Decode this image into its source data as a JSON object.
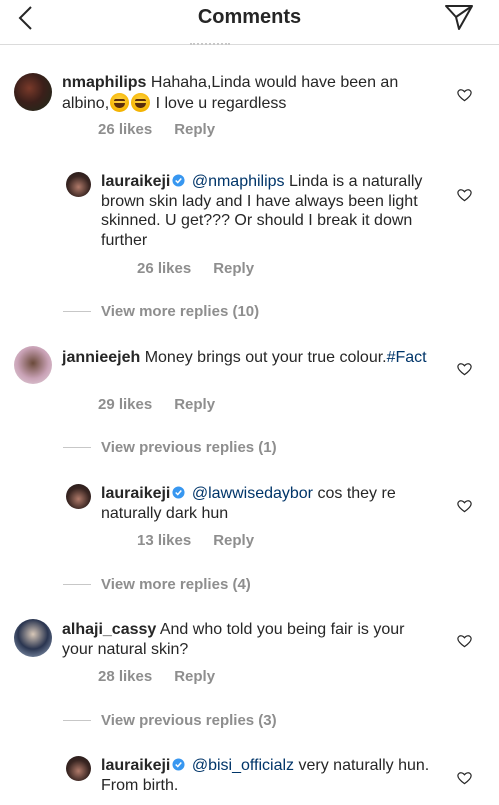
{
  "header": {
    "title": "Comments"
  },
  "comments": [
    {
      "username": "nmaphilips",
      "text": "Hahaha,Linda would have been an albino,",
      "text_after_emoji": "I love u regardless",
      "likes": "26 likes",
      "reply": "Reply"
    },
    {
      "username": "lauraikeji",
      "mention": "@nmaphilips",
      "text": "Linda is a naturally brown skin lady and I have always been light skinned. U get??? Or should I break it down further",
      "likes": "26 likes",
      "reply": "Reply"
    },
    {
      "viewmore": "View more replies (10)"
    },
    {
      "username": "jannieejeh",
      "text": "Money brings out your true colour.",
      "hashtag": "#Fact",
      "likes": "29 likes",
      "reply": "Reply"
    },
    {
      "viewmore": "View previous replies (1)"
    },
    {
      "username": "lauraikeji",
      "mention": "@lawwisedaybor",
      "text": "cos they re naturally dark hun",
      "likes": "13 likes",
      "reply": "Reply"
    },
    {
      "viewmore": "View more replies (4)"
    },
    {
      "username": "alhaji_cassy",
      "text": "And who told you being fair is your your natural skin?",
      "likes": "28 likes",
      "reply": "Reply"
    },
    {
      "viewmore": "View previous replies (3)"
    },
    {
      "username": "lauraikeji",
      "mention": "@bisi_officialz",
      "text": "very naturally hun. From birth."
    }
  ],
  "colors": {
    "link": "#003569",
    "secondary": "#8e8e8e",
    "verified": "#3897f0"
  },
  "icons": [
    "back-chevron-icon",
    "send-direct-icon",
    "heart-icon",
    "verified-badge-icon"
  ]
}
